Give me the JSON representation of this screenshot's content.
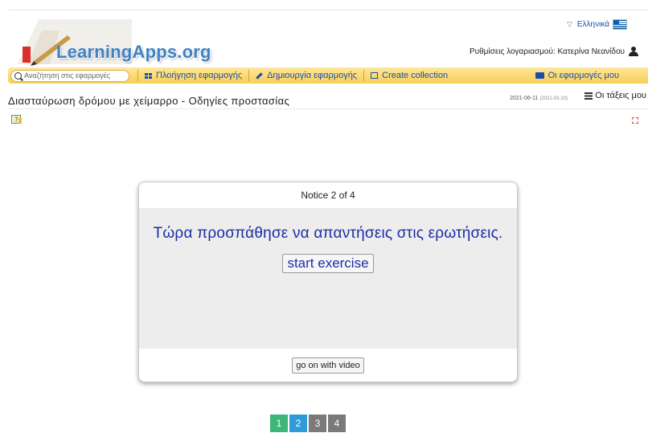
{
  "header": {
    "logo_text": "LearningApps.org",
    "language": "Ελληνικά",
    "account_label": "Ρυθμίσεις λογαριασμού: Κατερίνα Νεανίδου"
  },
  "nav": {
    "search_placeholder": "Αναζήτηση στις εφαρμογές",
    "items": [
      {
        "label": "Πλοήγηση εφαρμογής",
        "icon": "grid-icon"
      },
      {
        "label": "Δημιουργία εφαρμογής",
        "icon": "pencil-icon"
      },
      {
        "label": "Create collection",
        "icon": "collection-icon"
      }
    ],
    "my_apps": "Οι εφαρμογές μου",
    "bar_color": "#f6cf55"
  },
  "page": {
    "title": "Διασταύρωση δρόμου με χείμαρρο - Οδηγίες προστασίας",
    "date": "2021-06-11",
    "date_small": "(2021-03-10)",
    "classes_link": "Οι τάξεις μου"
  },
  "notice": {
    "heading": "Notice 2 of 4",
    "message": "Τώρα προσπάθησε να απαντήσεις στις ερωτήσεις.",
    "start_button": "start exercise",
    "continue_button": "go on with video"
  },
  "pagination": [
    {
      "label": "1",
      "color": "#3cb777"
    },
    {
      "label": "2",
      "color": "#2f9bd6"
    },
    {
      "label": "3",
      "color": "#7a7a7a"
    },
    {
      "label": "4",
      "color": "#7a7a7a"
    }
  ]
}
